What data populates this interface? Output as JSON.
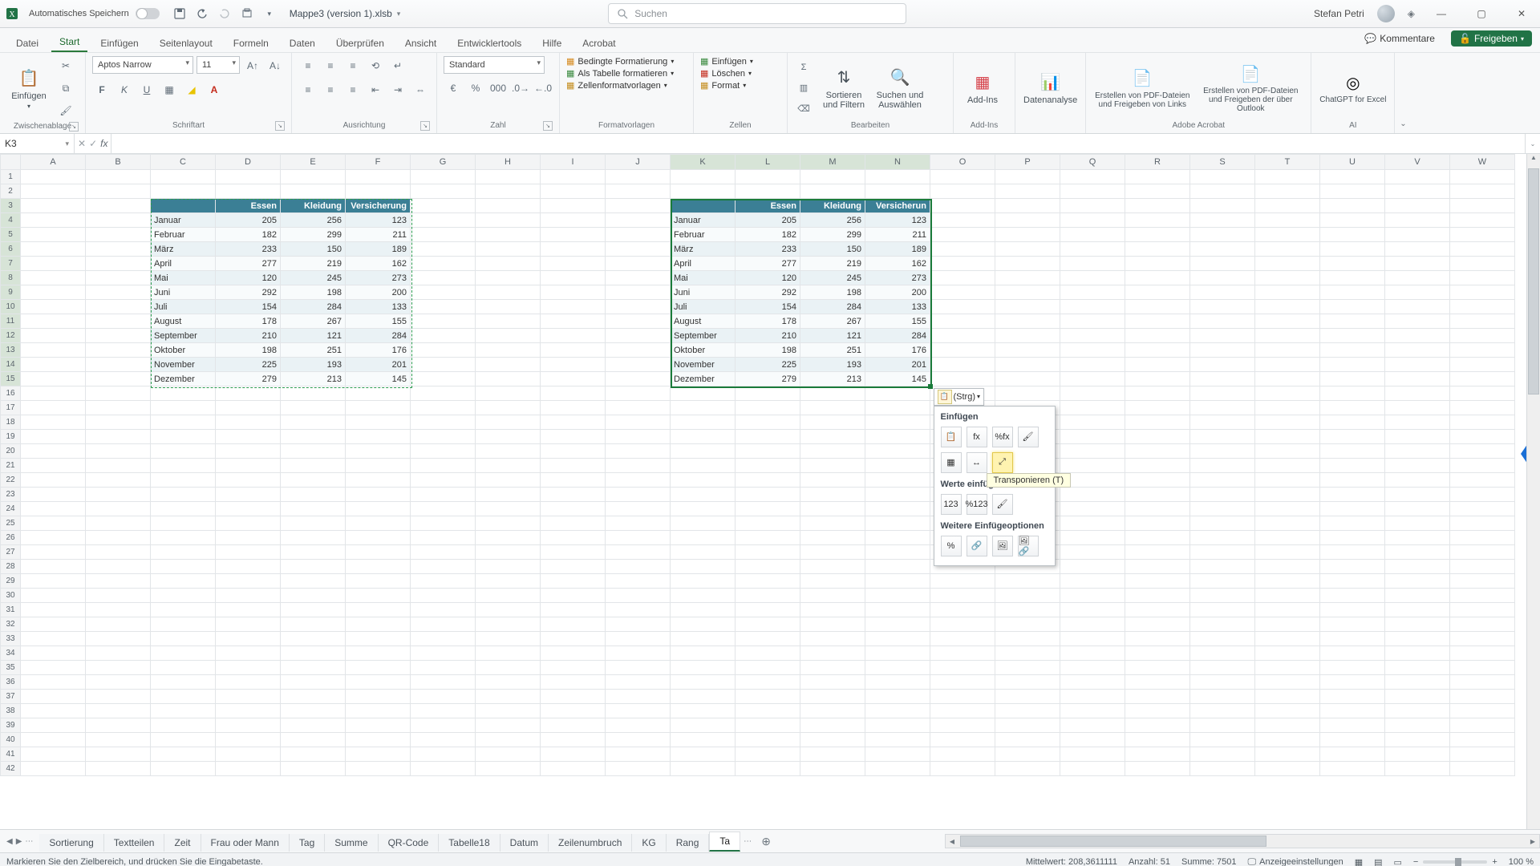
{
  "titlebar": {
    "autosave_label": "Automatisches Speichern",
    "filename": "Mappe3 (version 1).xlsb",
    "search_placeholder": "Suchen",
    "username": "Stefan Petri"
  },
  "tabs": {
    "file": "Datei",
    "start": "Start",
    "insert": "Einfügen",
    "pagelayout": "Seitenlayout",
    "formulas": "Formeln",
    "data": "Daten",
    "review": "Überprüfen",
    "view": "Ansicht",
    "devtools": "Entwicklertools",
    "help": "Hilfe",
    "acrobat": "Acrobat",
    "comments_btn": "Kommentare",
    "share_btn": "Freigeben"
  },
  "ribbon": {
    "clipboard": {
      "paste": "Einfügen",
      "group": "Zwischenablage"
    },
    "font": {
      "group": "Schriftart",
      "family": "Aptos Narrow",
      "size": "11"
    },
    "alignment": {
      "group": "Ausrichtung"
    },
    "number": {
      "group": "Zahl",
      "format": "Standard"
    },
    "styles": {
      "group": "Formatvorlagen",
      "cond": "Bedingte Formatierung",
      "tbl": "Als Tabelle formatieren",
      "cell": "Zellenformatvorlagen"
    },
    "cells": {
      "group": "Zellen",
      "insert": "Einfügen",
      "delete": "Löschen",
      "format": "Format"
    },
    "editing": {
      "group": "Bearbeiten",
      "sort": "Sortieren und Filtern",
      "find": "Suchen und Auswählen"
    },
    "addins": {
      "group": "Add-Ins",
      "label": "Add-Ins"
    },
    "analysis": {
      "label": "Datenanalyse"
    },
    "acrobat": {
      "group": "Adobe Acrobat",
      "pdf1": "Erstellen von PDF-Dateien und Freigeben von Links",
      "pdf2": "Erstellen von PDF-Dateien und Freigeben der über Outlook"
    },
    "ai": {
      "group": "AI",
      "label": "ChatGPT for Excel"
    }
  },
  "namebox": "K3",
  "columns": [
    "A",
    "B",
    "C",
    "D",
    "E",
    "F",
    "G",
    "H",
    "I",
    "J",
    "K",
    "L",
    "M",
    "N",
    "O",
    "P",
    "Q",
    "R",
    "S",
    "T",
    "U",
    "V",
    "W"
  ],
  "table": {
    "headers": [
      "",
      "Essen",
      "Kleidung",
      "Versicherung"
    ],
    "headers_right_trunc": "Versicherun",
    "rows": [
      [
        "Januar",
        205,
        256,
        123
      ],
      [
        "Februar",
        182,
        299,
        211
      ],
      [
        "März",
        233,
        150,
        189
      ],
      [
        "April",
        277,
        219,
        162
      ],
      [
        "Mai",
        120,
        245,
        273
      ],
      [
        "Juni",
        292,
        198,
        200
      ],
      [
        "Juli",
        154,
        284,
        133
      ],
      [
        "August",
        178,
        267,
        155
      ],
      [
        "September",
        210,
        121,
        284
      ],
      [
        "Oktober",
        198,
        251,
        176
      ],
      [
        "November",
        225,
        193,
        201
      ],
      [
        "Dezember",
        279,
        213,
        145
      ]
    ]
  },
  "paste_menu": {
    "ctrl_label": "(Strg)",
    "section_paste": "Einfügen",
    "section_values": "Werte einfügen",
    "section_more": "Weitere Einfügeoptionen",
    "tooltip": "Transponieren (T)"
  },
  "sheets": {
    "tabs": [
      "Sortierung",
      "Textteilen",
      "Zeit",
      "Frau oder Mann",
      "Tag",
      "Summe",
      "QR-Code",
      "Tabelle18",
      "Datum",
      "Zeilenumbruch",
      "KG",
      "Rang",
      "Ta"
    ]
  },
  "statusbar": {
    "left": "Markieren Sie den Zielbereich, und drücken Sie die Eingabetaste.",
    "avg_label": "Mittelwert:",
    "avg_value": "208,3611111",
    "count_label": "Anzahl:",
    "count_value": "51",
    "sum_label": "Summe:",
    "sum_value": "7501",
    "display_settings": "Anzeigeeinstellungen",
    "zoom": "100 %"
  }
}
